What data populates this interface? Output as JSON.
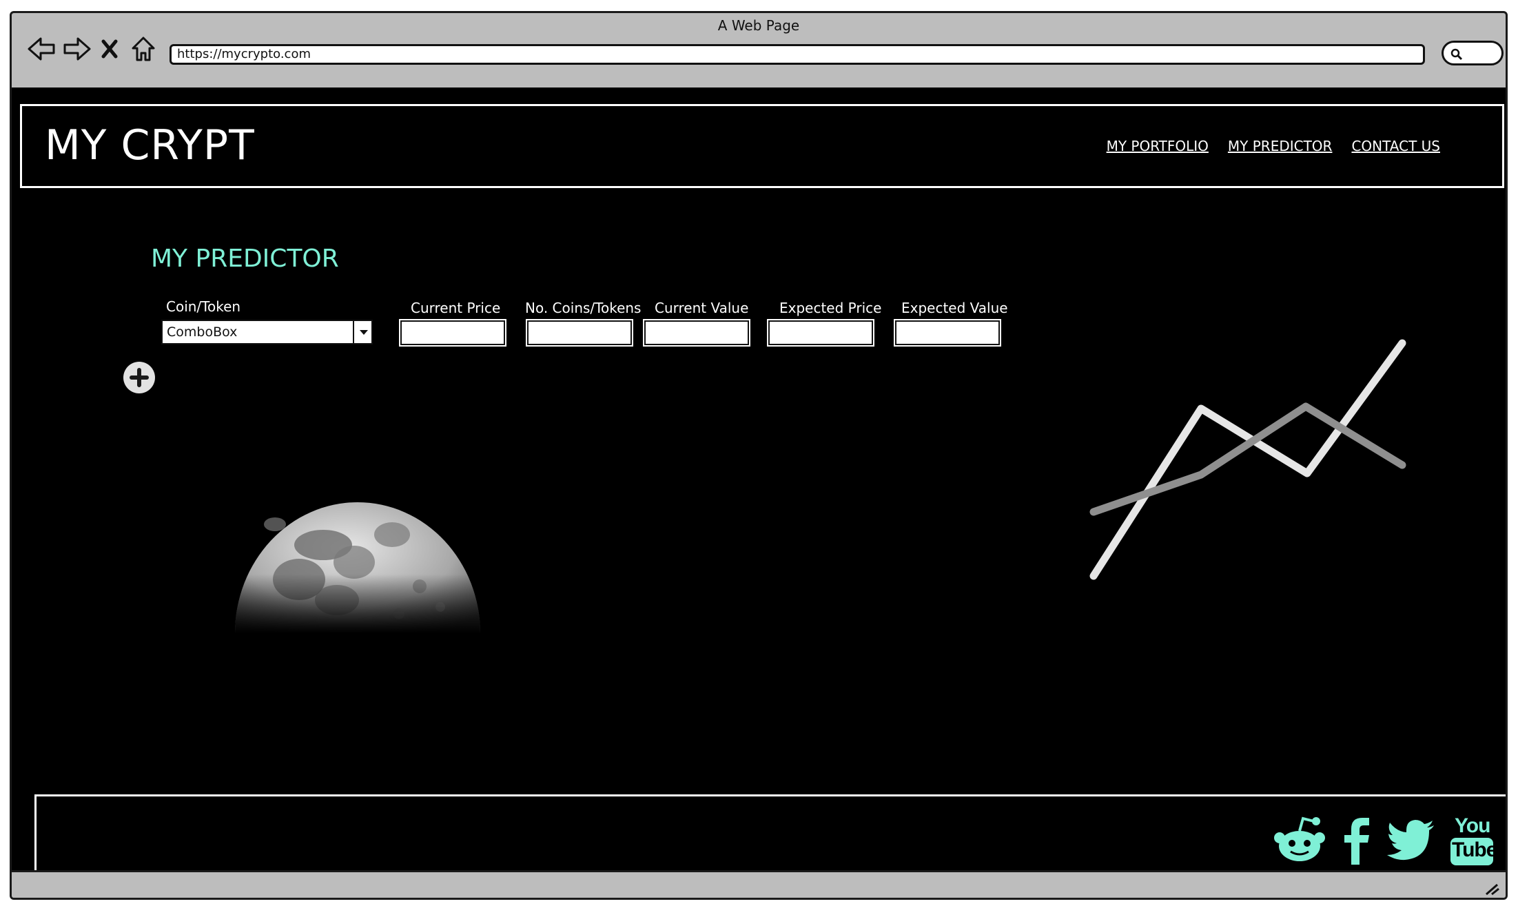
{
  "window": {
    "title": "A Web Page"
  },
  "browser": {
    "url": "https://mycrypto.com",
    "back_icon": "back-arrow-icon",
    "forward_icon": "forward-arrow-icon",
    "stop_icon": "close-icon",
    "home_icon": "home-icon",
    "search_icon": "search-icon"
  },
  "header": {
    "logo": "MY CRYPT",
    "nav": [
      "MY PORTFOLIO",
      "MY PREDICTOR",
      "CONTACT US"
    ]
  },
  "main": {
    "section_title": "MY PREDICTOR",
    "coin_label": "Coin/Token",
    "combo_value": "ComboBox",
    "columns": [
      "Current Price",
      "No. Coins/Tokens",
      "Current Value",
      "Expected Price",
      "Expected Value"
    ],
    "add_icon": "plus-circle-icon",
    "image_icon": "moon-image",
    "chart_icon": "line-chart-icon"
  },
  "footer": {
    "social_icons": [
      "reddit-icon",
      "facebook-icon",
      "twitter-icon",
      "youtube-icon"
    ],
    "youtube_text_top": "You",
    "youtube_text_bottom": "Tube"
  },
  "colors": {
    "accent": "#7ff0d6",
    "background": "#000000",
    "chrome": "#bdbdbd"
  }
}
